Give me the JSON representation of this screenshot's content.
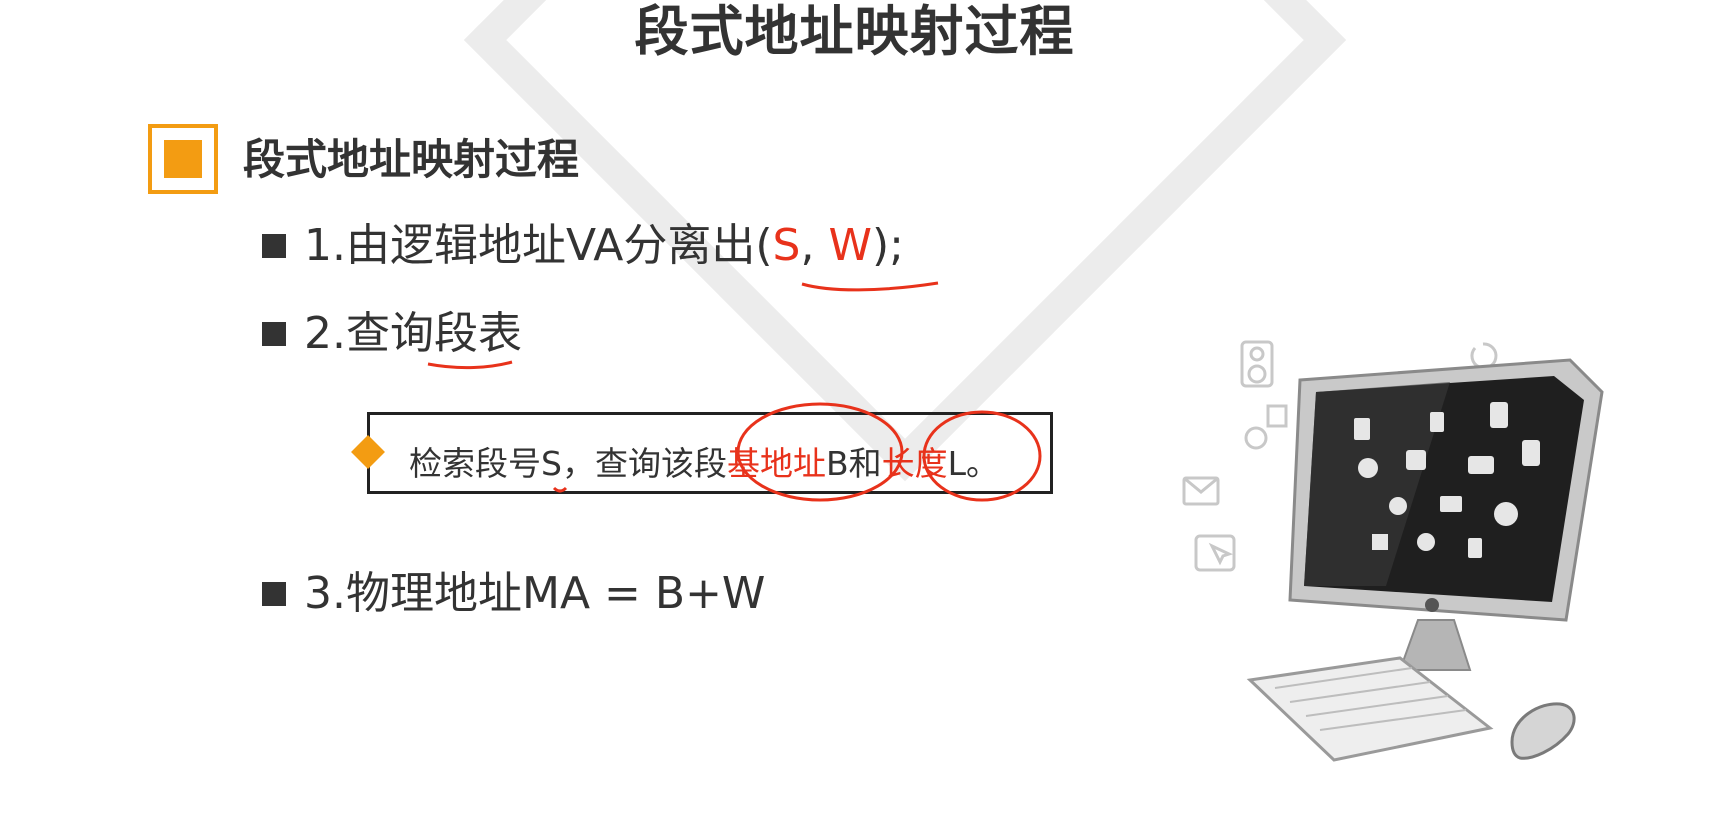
{
  "slide": {
    "title": "段式地址映射过程",
    "section_heading": "段式地址映射过程"
  },
  "steps": [
    {
      "prefix": "1.由逻辑地址VA分离出(",
      "highlight_s": "S",
      "sep": ", ",
      "highlight_w": "W",
      "suffix": ");"
    },
    {
      "text": "2.查询段表"
    },
    {
      "text": "3.物理地址MA =  B+W"
    }
  ],
  "detail": {
    "part1": "检索段号S，查询该段",
    "highlight1": "基地址",
    "part2": "B和",
    "highlight2": "长度",
    "part3": "L。"
  },
  "colors": {
    "accent_orange": "#f39c12",
    "annotation_red": "#e8321b",
    "text": "#333333"
  },
  "icons": [
    "section-square-icon",
    "bullet-square-icon",
    "diamond-bullet-icon",
    "computer-illustration"
  ]
}
